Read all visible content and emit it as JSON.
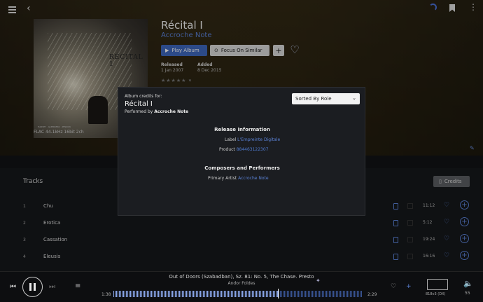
{
  "album": {
    "title": "Récital I",
    "artist": "Accroche Note",
    "cover_title": "RÉCITAL 1",
    "cover_credits": "HARVEY · GUERRERO · PESSON",
    "format": "FLAC 44.1kHz 16bit 2ch",
    "play_label": "Play Album",
    "focus_label": "Focus On Similar",
    "plus_label": "+",
    "released_label": "Released",
    "released_value": "1 Jan 2007",
    "added_label": "Added",
    "added_value": "8 Dec 2015",
    "rating_stars": "★★★★★ ▾"
  },
  "icons": {
    "back": "‹",
    "more": "⋮",
    "heart": "♡",
    "edit": "✎",
    "doc": "▯",
    "prev": "⏮",
    "next": "⏭",
    "queue": "≡",
    "volume": "🔈",
    "sparkle": "✦",
    "plus": "+",
    "chevron": "⌄"
  },
  "tracks": {
    "heading": "Tracks",
    "credits_label": "Credits",
    "rows": [
      {
        "num": "1",
        "name": "Chu",
        "duration": "11:12"
      },
      {
        "num": "2",
        "name": "Erotica",
        "duration": "5:12"
      },
      {
        "num": "3",
        "name": "Cassation",
        "duration": "19:24"
      },
      {
        "num": "4",
        "name": "Eleusis",
        "duration": "16:16"
      }
    ]
  },
  "modal": {
    "kicker": "Album credits for:",
    "title": "Récital I",
    "performed_prefix": "Performed by",
    "performed_artist": "Accroche Note",
    "sort_value": "Sorted By Role",
    "release_info_title": "Release Information",
    "label_key": "Label",
    "label_value": "L'Empreinte Digitale",
    "product_key": "Product",
    "product_value": "884463122307",
    "composers_title": "Composers and Performers",
    "primary_key": "Primary Artist",
    "primary_value": "Accroche Note"
  },
  "player": {
    "title": "Out of Doors (Szabadban), Sz. 81: No. 5, The Chase. Presto",
    "artist": "Andor Foldes",
    "time_current": "1:38",
    "time_total": "2:29",
    "progress_fraction": 0.66,
    "device_name": "818v3 (DX)",
    "volume": "55"
  }
}
